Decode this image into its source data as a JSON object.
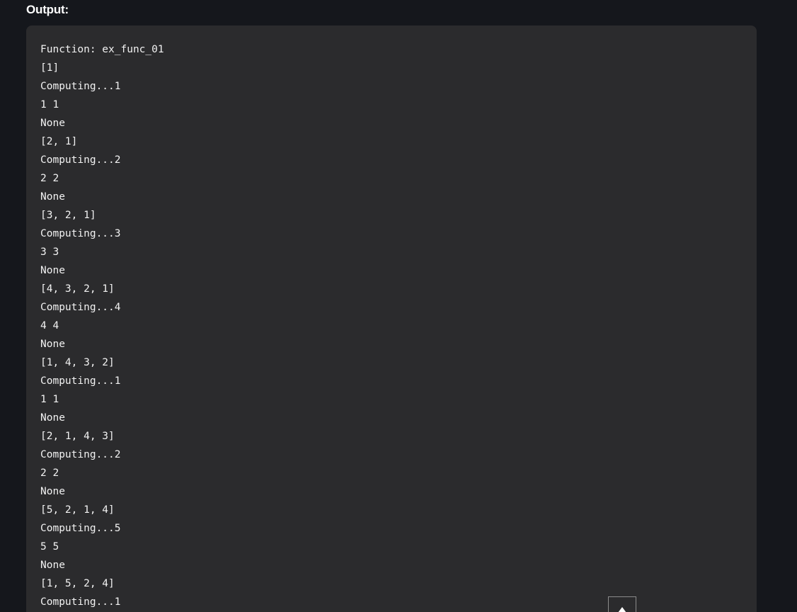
{
  "heading": "Output:",
  "output": {
    "lines": [
      "Function: ex_func_01",
      "[1]",
      "Computing...1",
      "1 1",
      "None",
      "[2, 1]",
      "Computing...2",
      "2 2",
      "None",
      "[3, 2, 1]",
      "Computing...3",
      "3 3",
      "None",
      "[4, 3, 2, 1]",
      "Computing...4",
      "4 4",
      "None",
      "[1, 4, 3, 2]",
      "Computing...1",
      "1 1",
      "None",
      "[2, 1, 4, 3]",
      "Computing...2",
      "2 2",
      "None",
      "[5, 2, 1, 4]",
      "Computing...5",
      "5 5",
      "None",
      "[1, 5, 2, 4]",
      "Computing...1"
    ]
  },
  "scroll_top_button": {
    "icon": "arrow-up-icon"
  },
  "colors": {
    "page_background": "#15171c",
    "output_background": "#2b2b2d",
    "text": "#f2f2f2"
  }
}
